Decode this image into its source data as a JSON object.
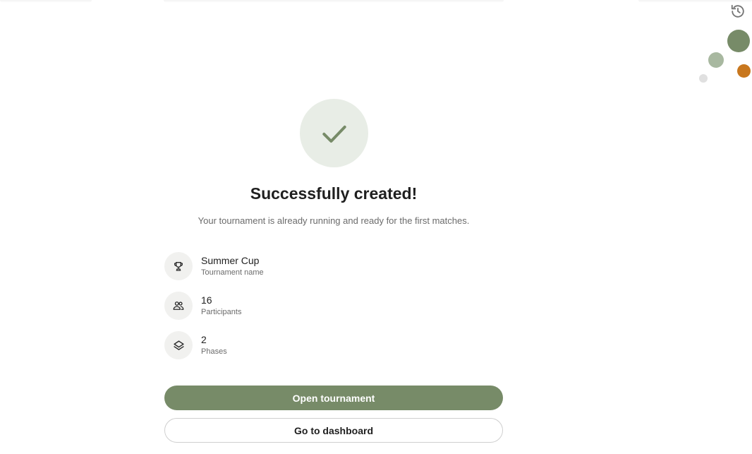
{
  "colors": {
    "accent": "#778b68",
    "accent_light": "#e8ede6",
    "accent_mid": "#a8b8a0",
    "orange": "#c8771e",
    "gray_dot": "#e0e0e0"
  },
  "header": {
    "history_icon": "history-icon"
  },
  "success": {
    "icon": "checkmark-icon",
    "title": "Successfully created!",
    "subtitle": "Your tournament is already running and ready for the first matches."
  },
  "details": [
    {
      "icon": "trophy-icon",
      "value": "Summer Cup",
      "label": "Tournament name"
    },
    {
      "icon": "participants-icon",
      "value": "16",
      "label": "Participants"
    },
    {
      "icon": "layers-icon",
      "value": "2",
      "label": "Phases"
    }
  ],
  "actions": {
    "primary_label": "Open tournament",
    "secondary_label": "Go to dashboard"
  }
}
